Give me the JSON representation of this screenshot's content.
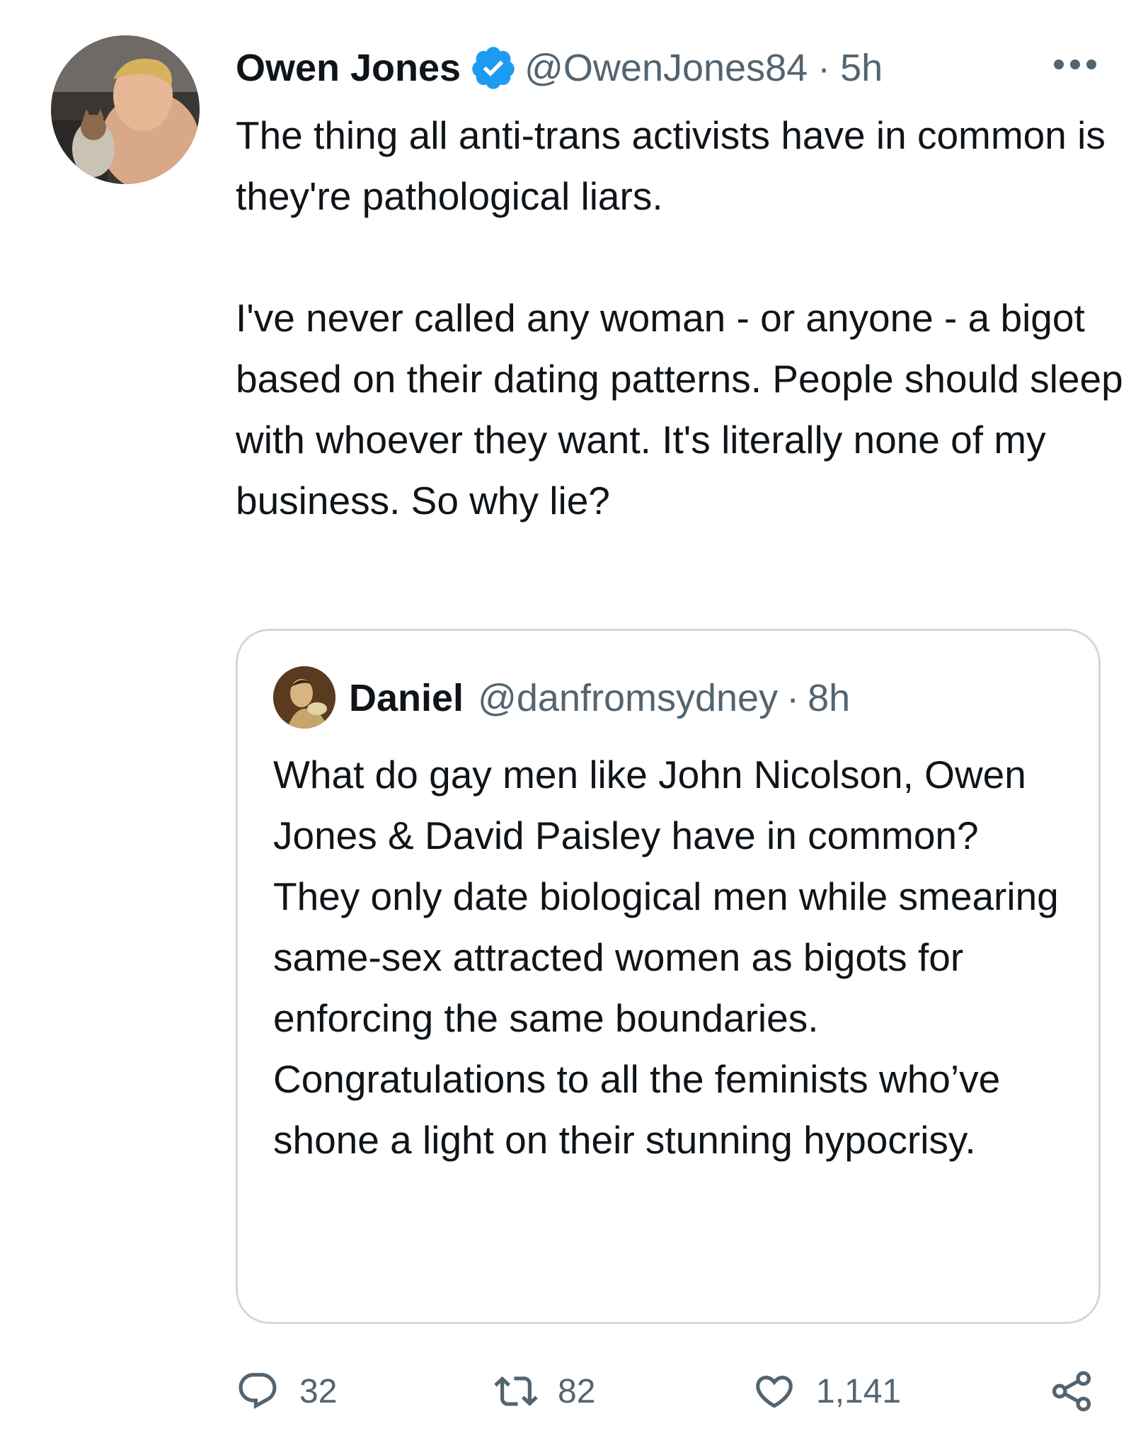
{
  "tweet": {
    "author": {
      "name": "Owen Jones",
      "handle": "@OwenJones84",
      "separator": "·",
      "time": "5h",
      "verified": true,
      "avatar_icon": "profile-photo"
    },
    "more_icon": "more-horizontal-icon",
    "paragraphs": [
      "The thing all anti-trans activists have in common is they're pathological liars.",
      "I've never called any woman - or anyone - a bigot based on their dating patterns. People should sleep with whoever they want. It's literally none of my business. So why lie?"
    ]
  },
  "quoted_tweet": {
    "name": "Daniel",
    "handle": "@danfromsydney",
    "separator": "·",
    "time": "8h",
    "avatar_icon": "painting-avatar",
    "text": "What do gay men like John Nicolson, Owen Jones & David Paisley have in common? They only date biological men while smearing same-sex attracted women as bigots for enforcing the same boundaries. Congratulations to all the feminists who’ve shone a light on their stunning hypocrisy."
  },
  "actions": {
    "reply": {
      "icon": "reply-icon",
      "count": "32"
    },
    "retweet": {
      "icon": "retweet-icon",
      "count": "82"
    },
    "like": {
      "icon": "heart-icon",
      "count": "1,141"
    },
    "share": {
      "icon": "share-icon"
    }
  },
  "colors": {
    "text": "#0f1419",
    "secondary": "#536471",
    "verified": "#1d9bf0",
    "border": "#cfd9de"
  }
}
